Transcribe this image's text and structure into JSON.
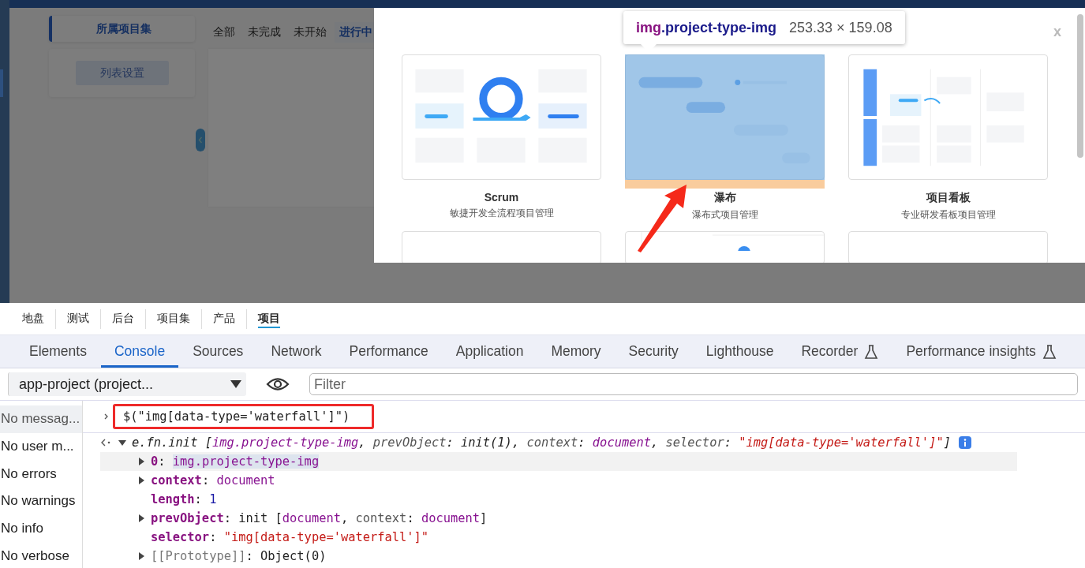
{
  "page": {
    "group_button": "所属项目集",
    "settings_button": "列表设置",
    "filters": [
      {
        "label": "全部",
        "selected": false
      },
      {
        "label": "未完成",
        "selected": false
      },
      {
        "label": "未开始",
        "selected": false
      },
      {
        "label": "进行中",
        "selected": true
      }
    ]
  },
  "modal": {
    "close": "x",
    "cards": [
      {
        "kind": "scrum",
        "title": "Scrum",
        "subtitle": "敏捷开发全流程项目管理",
        "highlighted": false
      },
      {
        "kind": "waterfall",
        "title": "瀑布",
        "subtitle": "瀑布式项目管理",
        "highlighted": true
      },
      {
        "kind": "kanban",
        "title": "项目看板",
        "subtitle": "专业研发看板项目管理",
        "highlighted": false
      }
    ],
    "lower_cards": [
      {
        "kind": "blank"
      },
      {
        "kind": "timeline"
      },
      {
        "kind": "blank"
      }
    ]
  },
  "inspector_tooltip": {
    "tag": "img",
    "class": ".project-type-img",
    "size": "253.33 × 159.08"
  },
  "app_tabs": [
    {
      "label": "地盘",
      "selected": false
    },
    {
      "label": "测试",
      "selected": false
    },
    {
      "label": "后台",
      "selected": false
    },
    {
      "label": "项目集",
      "selected": false
    },
    {
      "label": "产品",
      "selected": false
    },
    {
      "label": "项目",
      "selected": true
    }
  ],
  "devtools": {
    "tabs": [
      {
        "label": "Elements",
        "selected": false,
        "experimental": false
      },
      {
        "label": "Console",
        "selected": true,
        "experimental": false
      },
      {
        "label": "Sources",
        "selected": false,
        "experimental": false
      },
      {
        "label": "Network",
        "selected": false,
        "experimental": false
      },
      {
        "label": "Performance",
        "selected": false,
        "experimental": false
      },
      {
        "label": "Application",
        "selected": false,
        "experimental": false
      },
      {
        "label": "Memory",
        "selected": false,
        "experimental": false
      },
      {
        "label": "Security",
        "selected": false,
        "experimental": false
      },
      {
        "label": "Lighthouse",
        "selected": false,
        "experimental": false
      },
      {
        "label": "Recorder",
        "selected": false,
        "experimental": true
      },
      {
        "label": "Performance insights",
        "selected": false,
        "experimental": true
      }
    ],
    "context": "app-project (project...",
    "filter_placeholder": "Filter",
    "sidebar": [
      {
        "label": "No messag...",
        "selected": true
      },
      {
        "label": "No user m...",
        "selected": false
      },
      {
        "label": "No errors",
        "selected": false
      },
      {
        "label": "No warnings",
        "selected": false
      },
      {
        "label": "No info",
        "selected": false
      },
      {
        "label": "No verbose",
        "selected": false
      }
    ],
    "input": {
      "text": "$(\"img[data-type='waterfall']\")",
      "annotated": true
    },
    "result": {
      "expanded": true,
      "tokens": [
        {
          "text": "e.fn.init [",
          "kind": "plain"
        },
        {
          "text": "img.project-type-img",
          "kind": "node"
        },
        {
          "text": ", ",
          "kind": "plain"
        },
        {
          "text": "prevObject",
          "kind": "prop"
        },
        {
          "text": ": init(1), ",
          "kind": "plain"
        },
        {
          "text": "context",
          "kind": "prop"
        },
        {
          "text": ": ",
          "kind": "plain"
        },
        {
          "text": "document",
          "kind": "name"
        },
        {
          "text": ", ",
          "kind": "plain"
        },
        {
          "text": "selector",
          "kind": "prop"
        },
        {
          "text": ": ",
          "kind": "plain"
        },
        {
          "text": "\"img[data-type='waterfall']\"",
          "kind": "str"
        },
        {
          "text": "]",
          "kind": "plain"
        }
      ]
    },
    "properties": [
      {
        "expandable": true,
        "hovered": true,
        "tokens": [
          {
            "text": "0",
            "kind": "key"
          },
          {
            "text": ": ",
            "kind": "plain"
          },
          {
            "text": "img.project-type-img",
            "kind": "node"
          }
        ]
      },
      {
        "expandable": true,
        "hovered": false,
        "tokens": [
          {
            "text": "context",
            "kind": "key"
          },
          {
            "text": ": ",
            "kind": "plain"
          },
          {
            "text": "document",
            "kind": "name"
          }
        ]
      },
      {
        "expandable": false,
        "hovered": false,
        "tokens": [
          {
            "text": "length",
            "kind": "key"
          },
          {
            "text": ": ",
            "kind": "plain"
          },
          {
            "text": "1",
            "kind": "num"
          }
        ]
      },
      {
        "expandable": true,
        "hovered": false,
        "tokens": [
          {
            "text": "prevObject",
            "kind": "key"
          },
          {
            "text": ": ",
            "kind": "plain"
          },
          {
            "text": "init [",
            "kind": "plain"
          },
          {
            "text": "document",
            "kind": "name"
          },
          {
            "text": ", ",
            "kind": "plain"
          },
          {
            "text": "context",
            "kind": "prop"
          },
          {
            "text": ": ",
            "kind": "plain"
          },
          {
            "text": "document",
            "kind": "name"
          },
          {
            "text": "]",
            "kind": "plain"
          }
        ]
      },
      {
        "expandable": false,
        "hovered": false,
        "tokens": [
          {
            "text": "selector",
            "kind": "key"
          },
          {
            "text": ": ",
            "kind": "plain"
          },
          {
            "text": "\"img[data-type='waterfall']\"",
            "kind": "str"
          }
        ]
      },
      {
        "expandable": true,
        "hovered": false,
        "tokens": [
          {
            "text": "[[Prototype]]",
            "kind": "internal"
          },
          {
            "text": ": ",
            "kind": "plain"
          },
          {
            "text": "Object(0)",
            "kind": "plain"
          }
        ]
      }
    ]
  }
}
